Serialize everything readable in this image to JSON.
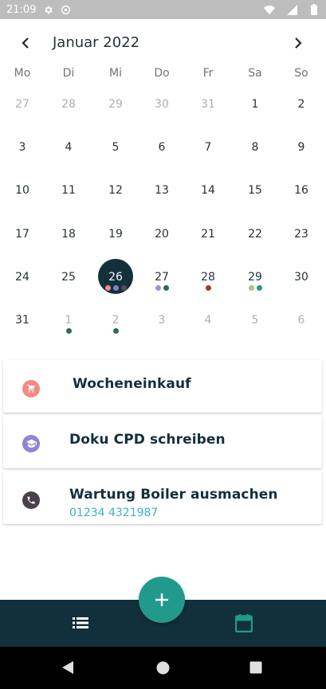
{
  "status_bar": {
    "time": "21:09",
    "icons_left": [
      "gear-icon",
      "at-icon"
    ],
    "icons_right": [
      "wifi-icon",
      "signal-icon",
      "battery-icon"
    ]
  },
  "calendar": {
    "month_title": "Januar 2022",
    "weekdays": [
      "Mo",
      "Di",
      "Mi",
      "Do",
      "Fr",
      "Sa",
      "So"
    ],
    "weeks": [
      [
        {
          "d": "27",
          "muted": true
        },
        {
          "d": "28",
          "muted": true
        },
        {
          "d": "29",
          "muted": true
        },
        {
          "d": "30",
          "muted": true
        },
        {
          "d": "31",
          "muted": true
        },
        {
          "d": "1"
        },
        {
          "d": "2"
        }
      ],
      [
        {
          "d": "3"
        },
        {
          "d": "4"
        },
        {
          "d": "5"
        },
        {
          "d": "6"
        },
        {
          "d": "7"
        },
        {
          "d": "8"
        },
        {
          "d": "9"
        }
      ],
      [
        {
          "d": "10"
        },
        {
          "d": "11"
        },
        {
          "d": "12"
        },
        {
          "d": "13"
        },
        {
          "d": "14"
        },
        {
          "d": "15"
        },
        {
          "d": "16"
        }
      ],
      [
        {
          "d": "17"
        },
        {
          "d": "18"
        },
        {
          "d": "19"
        },
        {
          "d": "20"
        },
        {
          "d": "21"
        },
        {
          "d": "22"
        },
        {
          "d": "23"
        }
      ],
      [
        {
          "d": "24"
        },
        {
          "d": "25"
        },
        {
          "d": "26",
          "selected": true,
          "dots": [
            "#f28b82",
            "#7e7ed9",
            "#5a4a55"
          ]
        },
        {
          "d": "27",
          "dots": [
            "#9c92d8",
            "#2e6b55"
          ]
        },
        {
          "d": "28",
          "dots": [
            "#a63a22"
          ]
        },
        {
          "d": "29",
          "dots": [
            "#a6c77d",
            "#1f9a8c"
          ]
        },
        {
          "d": "30"
        }
      ],
      [
        {
          "d": "31"
        },
        {
          "d": "1",
          "muted": true,
          "dots": [
            "#2e6b55"
          ]
        },
        {
          "d": "2",
          "muted": true,
          "dots": [
            "#2e6b55"
          ]
        },
        {
          "d": "3",
          "muted": true
        },
        {
          "d": "4",
          "muted": true
        },
        {
          "d": "5",
          "muted": true
        },
        {
          "d": "6",
          "muted": true
        }
      ]
    ]
  },
  "events": [
    {
      "title": "Wocheneinkauf",
      "icon": "cart-icon",
      "color": "#f28b82"
    },
    {
      "title": "Doku CPD schreiben",
      "icon": "graduation-cap-icon",
      "color": "#8f85d6"
    },
    {
      "title": "Wartung Boiler ausmachen",
      "subtitle": "01234 4321987",
      "icon": "phone-icon",
      "color": "#4a3f4b"
    }
  ],
  "bottom_nav": {
    "list_icon": "list-icon",
    "calendar_icon": "calendar-icon",
    "fab_icon": "plus-icon"
  },
  "colors": {
    "primary_dark": "#12303b",
    "accent": "#229a8b",
    "link": "#3bb1c7"
  }
}
